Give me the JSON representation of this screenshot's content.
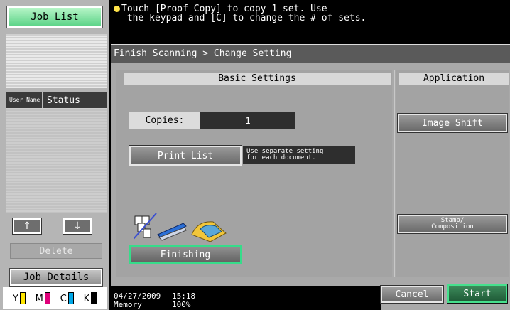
{
  "left_panel": {
    "job_list_label": "Job List",
    "queue_header": {
      "user_name": "User Name",
      "status": "Status"
    },
    "up_arrow": "↑",
    "down_arrow": "↓",
    "delete_label": "Delete",
    "job_details_label": "Job Details",
    "toner": [
      {
        "label": "Y",
        "color": "#ffe600"
      },
      {
        "label": "M",
        "color": "#e0007a"
      },
      {
        "label": "C",
        "color": "#00a8e8"
      },
      {
        "label": "K",
        "color": "#000000"
      }
    ]
  },
  "message": {
    "line1": "Touch [Proof Copy] to copy 1 set. Use",
    "line2": " the keypad and [C] to change the # of sets."
  },
  "breadcrumb": "Finish Scanning > Change Setting",
  "basic": {
    "header": "Basic Settings",
    "copies_label": "Copies:",
    "copies_value": "1",
    "print_list_label": "Print List",
    "separate_note_line1": "Use separate setting",
    "separate_note_line2": "for each document.",
    "finishing_label": "Finishing"
  },
  "application": {
    "header": "Application",
    "image_shift_label": "Image Shift",
    "stamp_line1": "Stamp/",
    "stamp_line2": "Composition"
  },
  "status": {
    "date": "04/27/2009",
    "time": "15:18",
    "memory_label": "Memory",
    "memory_value": "100%"
  },
  "actions": {
    "cancel_label": "Cancel",
    "start_label": "Start"
  },
  "colors": {
    "accent_green": "#46e08d",
    "panel_gray": "#a9a9a9",
    "dark_field": "#2e2e2e"
  }
}
